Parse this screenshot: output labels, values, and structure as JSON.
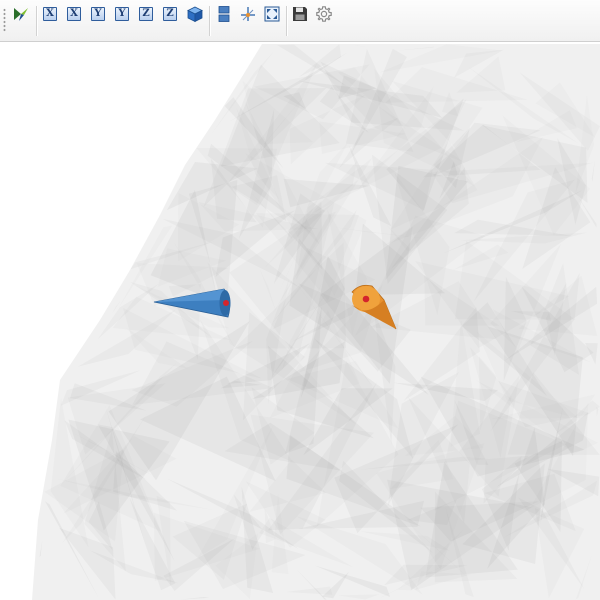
{
  "toolbar": {
    "buttons": [
      {
        "id": "logo",
        "icon": "paraview-logo-icon"
      },
      {
        "id": "view-pos-x",
        "icon": "axis-x-icon",
        "label": "X"
      },
      {
        "id": "view-neg-x",
        "icon": "axis-x-icon",
        "label": "X"
      },
      {
        "id": "view-pos-y",
        "icon": "axis-y-icon",
        "label": "Y"
      },
      {
        "id": "view-neg-y",
        "icon": "axis-y-icon",
        "label": "Y"
      },
      {
        "id": "view-pos-z",
        "icon": "axis-z-icon",
        "label": "Z"
      },
      {
        "id": "view-neg-z",
        "icon": "axis-z-icon",
        "label": "Z"
      },
      {
        "id": "isometric-view",
        "icon": "cube-icon"
      },
      {
        "id": "split-view",
        "icon": "split-view-icon"
      },
      {
        "id": "reset-center",
        "icon": "center-axes-icon"
      },
      {
        "id": "fullscreen",
        "icon": "fullscreen-icon"
      },
      {
        "id": "save",
        "icon": "save-icon"
      },
      {
        "id": "settings",
        "icon": "gear-icon"
      }
    ]
  },
  "colors": {
    "mesh_gray": "#8c8c8c",
    "blue_cone": "#3d7fc0",
    "orange_cone": "#e8912f",
    "marker_red": "#d4242c",
    "toolbar_bg": "#f3f3f3"
  }
}
